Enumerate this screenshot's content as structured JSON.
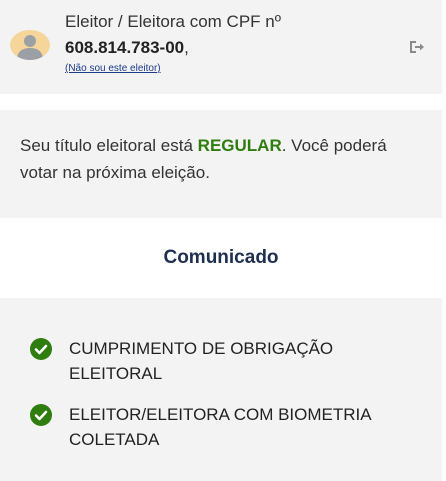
{
  "header": {
    "voter_prefix": "Eleitor / Eleitora com CPF nº",
    "cpf": "608.814.783-00",
    "cpf_suffix": ",",
    "not_me_link": "(Não sou este eleitor)"
  },
  "status": {
    "text_before": "Seu título eleitoral está ",
    "status_word": "REGULAR",
    "text_after": ". Você poderá votar na próxima eleição.",
    "status_color": "#2e7d0e"
  },
  "notice": {
    "title": "Comunicado",
    "items": [
      {
        "text": "CUMPRIMENTO DE OBRIGAÇÃO ELEITORAL"
      },
      {
        "text": "ELEITOR/ELEITORA COM BIOMETRIA COLETADA"
      }
    ]
  },
  "colors": {
    "check_green": "#2e7d0e",
    "title_navy": "#1f2f4f",
    "avatar_bg": "#f5d59a"
  }
}
